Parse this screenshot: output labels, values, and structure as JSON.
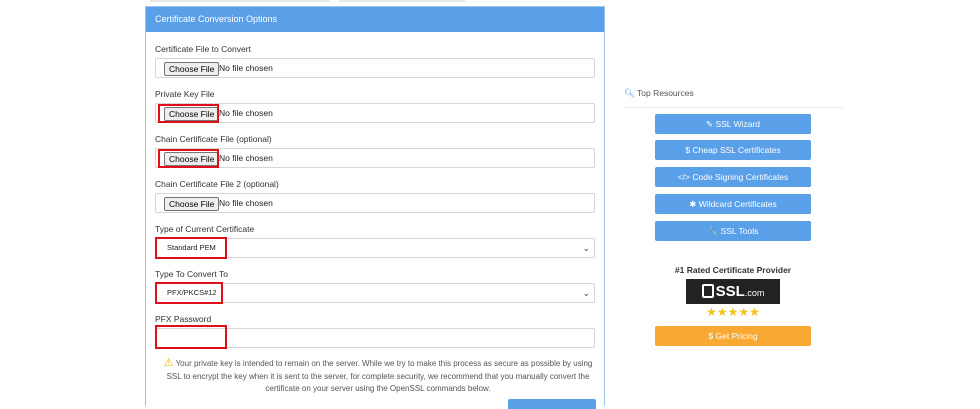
{
  "panel": {
    "title": "Certificate Conversion Options"
  },
  "fields": [
    {
      "label": "Certificate File to Convert",
      "button": "Choose File",
      "status": "No file chosen"
    },
    {
      "label": "Private Key File",
      "button": "Choose File",
      "status": "No file chosen"
    },
    {
      "label": "Chain Certificate File (optional)",
      "button": "Choose File",
      "status": "No file chosen"
    },
    {
      "label": "Chain Certificate File 2 (optional)",
      "button": "Choose File",
      "status": "No file chosen"
    }
  ],
  "current_type": {
    "label": "Type of Current Certificate",
    "value": "Standard PEM"
  },
  "convert_to": {
    "label": "Type To Convert To",
    "value": "PFX/PKCS#12"
  },
  "pfx": {
    "label": "PFX Password",
    "value": ""
  },
  "warning": {
    "icon": "warning-icon",
    "text": "Your private key is intended to remain on the server. While we try to make this process as secure as possible by using SSL to encrypt the key when it is sent to the server, for complete security, we recommend that you manually convert the certificate on your server using the OpenSSL commands below."
  },
  "sidebar": {
    "title": "Top Resources",
    "buttons": [
      {
        "icon": "magic-wand-icon",
        "glyph": "✎",
        "label": "SSL Wizard"
      },
      {
        "icon": "dollar-icon",
        "glyph": "$",
        "label": "Cheap SSL Certificates"
      },
      {
        "icon": "code-icon",
        "glyph": "</>",
        "label": "Code Signing Certificates"
      },
      {
        "icon": "asterisk-icon",
        "glyph": "✱",
        "label": "Wildcard Certificates"
      },
      {
        "icon": "wrench-icon",
        "glyph": "🔧",
        "label": "SSL Tools"
      }
    ],
    "rated": "#1 Rated Certificate Provider",
    "logo_text": "SSL",
    "logo_suffix": ".com",
    "rating_stars": 5,
    "pricing_label": "$ Get Pricing"
  },
  "colors": {
    "accent": "#5aa0e8",
    "highlight": "#e0101a",
    "pricing": "#f7a934",
    "stars": "#f2c318"
  }
}
